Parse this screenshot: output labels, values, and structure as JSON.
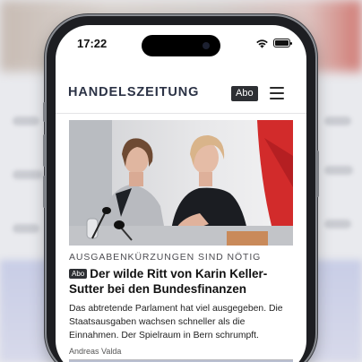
{
  "status_bar": {
    "time": "17:22"
  },
  "header": {
    "logo": "HANDELSZEITUNG",
    "abo_button": "Abo"
  },
  "article": {
    "kicker": "AUSGABENKÜRZUNGEN SIND NÖTIG",
    "badge": "Abo",
    "headline": "Der wilde Ritt von Karin Keller-Sutter bei den Bundesfinanzen",
    "lead": "Das abtretende Parlament hat viel ausgegeben. Die Staatsausgaben wachsen schneller als die Einnahmen. Der Spielraum in Bern schrumpft.",
    "author": "Andreas Valda"
  },
  "colors": {
    "ink": "#2b3245",
    "badge_bg": "#2d2f33",
    "swiss_red": "#d22b2b"
  },
  "icons": [
    "wifi-icon",
    "battery-icon",
    "hamburger-menu-icon"
  ]
}
